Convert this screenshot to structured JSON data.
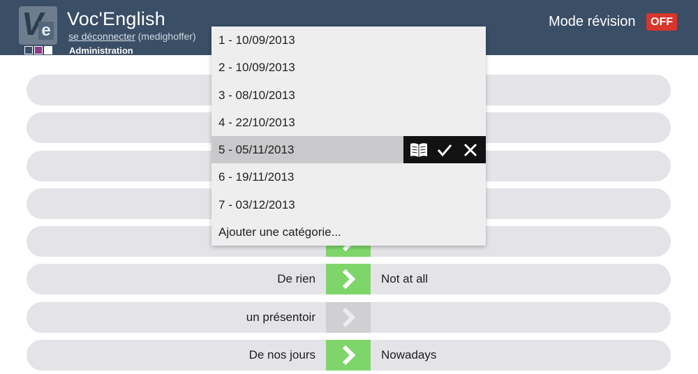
{
  "header": {
    "app_title": "Voc'English",
    "logo_letters": "Ve",
    "logout_label": "se déconnecter",
    "username": "(medighoffer)",
    "admin_label": "Administration",
    "mode_label": "Mode révision",
    "mode_toggle": "OFF",
    "swatch_colors": [
      "#3a4e66",
      "#8e3a8c",
      "#ffffff"
    ]
  },
  "dropdown": {
    "items": [
      "1 - 10/09/2013",
      "2 - 10/09/2013",
      "3 - 08/10/2013",
      "4 - 22/10/2013",
      "5 - 05/11/2013",
      "6 - 19/11/2013",
      "7 - 03/12/2013",
      "Ajouter une catégorie..."
    ],
    "selected_index": 4,
    "actions": [
      "book-icon",
      "check-icon",
      "close-icon"
    ]
  },
  "rows": [
    {
      "fr": "",
      "en": "",
      "status": "hidden"
    },
    {
      "fr": "",
      "en": "",
      "status": "hidden"
    },
    {
      "fr": "",
      "en": "",
      "status": "hidden"
    },
    {
      "fr": "",
      "en": "",
      "status": "hidden"
    },
    {
      "fr": "",
      "en": "",
      "status": "known"
    },
    {
      "fr": "De rien",
      "en": "Not at all",
      "status": "known"
    },
    {
      "fr": "un présentoir",
      "en": "",
      "status": "unknown"
    },
    {
      "fr": "De nos jours",
      "en": "Nowadays",
      "status": "known"
    }
  ],
  "colors": {
    "header_bg": "#3a4e66",
    "known_green": "#7ed66a",
    "unknown_gray": "#d0d0d3",
    "toggle_red": "#d6362b",
    "row_bg": "#e4e3e8"
  }
}
